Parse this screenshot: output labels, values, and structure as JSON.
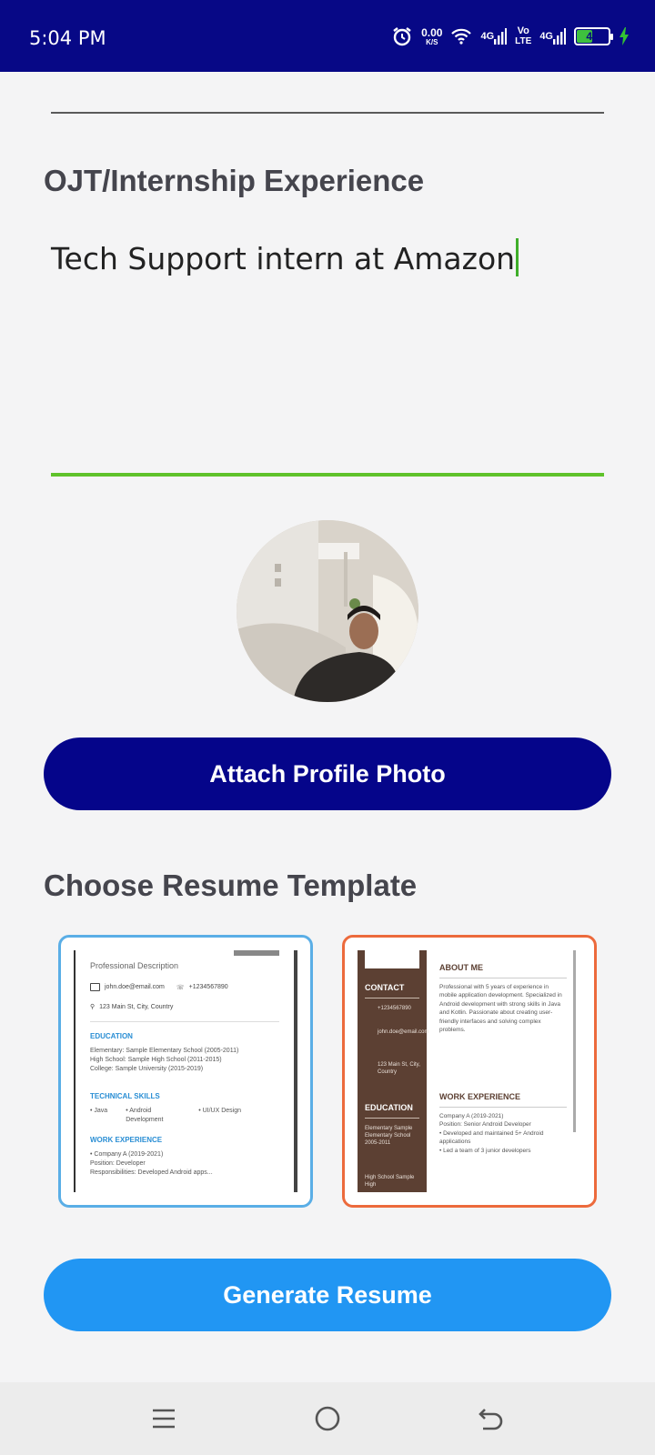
{
  "status_bar": {
    "time": "5:04 PM",
    "speed_value": "0.00",
    "speed_unit": "K/S",
    "net1": "4G",
    "volte_top": "Vo",
    "volte_bottom": "LTE",
    "net2": "4G",
    "battery": "46",
    "battery_level": 0.46
  },
  "form": {
    "ojt_label": "OJT/Internship Experience",
    "ojt_value": "Tech Support intern at Amazon",
    "attach_button": "Attach Profile Photo",
    "template_label": "Choose Resume Template",
    "generate_button": "Generate Resume"
  },
  "template1": {
    "description": "Professional Description",
    "email": "john.doe@email.com",
    "phone": "+1234567890",
    "address": "123 Main St, City, Country",
    "education_heading": "EDUCATION",
    "education_lines": [
      "Elementary: Sample Elementary School (2005-2011)",
      "High School: Sample High School (2011-2015)",
      "College: Sample University (2015-2019)"
    ],
    "skills_heading": "TECHNICAL SKILLS",
    "skills": [
      "• Java",
      "• Android Development",
      "• UI/UX Design"
    ],
    "work_heading": "WORK EXPERIENCE",
    "work_lines": [
      "• Company A (2019-2021)",
      "Position: Developer",
      "Responsibilities: Developed Android apps..."
    ]
  },
  "template2": {
    "contact_heading": "CONTACT",
    "phone": "+1234567890",
    "email": "john.doe@email.com",
    "address": "123 Main St, City, Country",
    "education_heading": "EDUCATION",
    "education_text": "Elementary Sample Elementary School 2005-2011",
    "education_text2": "High School Sample High",
    "about_heading": "ABOUT ME",
    "about_text": "Professional with 5 years of experience in mobile application development. Specialized in Android development with strong skills in Java and Kotlin. Passionate about creating user-friendly interfaces and solving complex problems.",
    "work_heading": "WORK EXPERIENCE",
    "work_lines": [
      "Company A (2019-2021)",
      "Position: Senior Android Developer",
      "• Developed and maintained 5+ Android applications",
      "• Led a team of 3 junior developers"
    ]
  }
}
